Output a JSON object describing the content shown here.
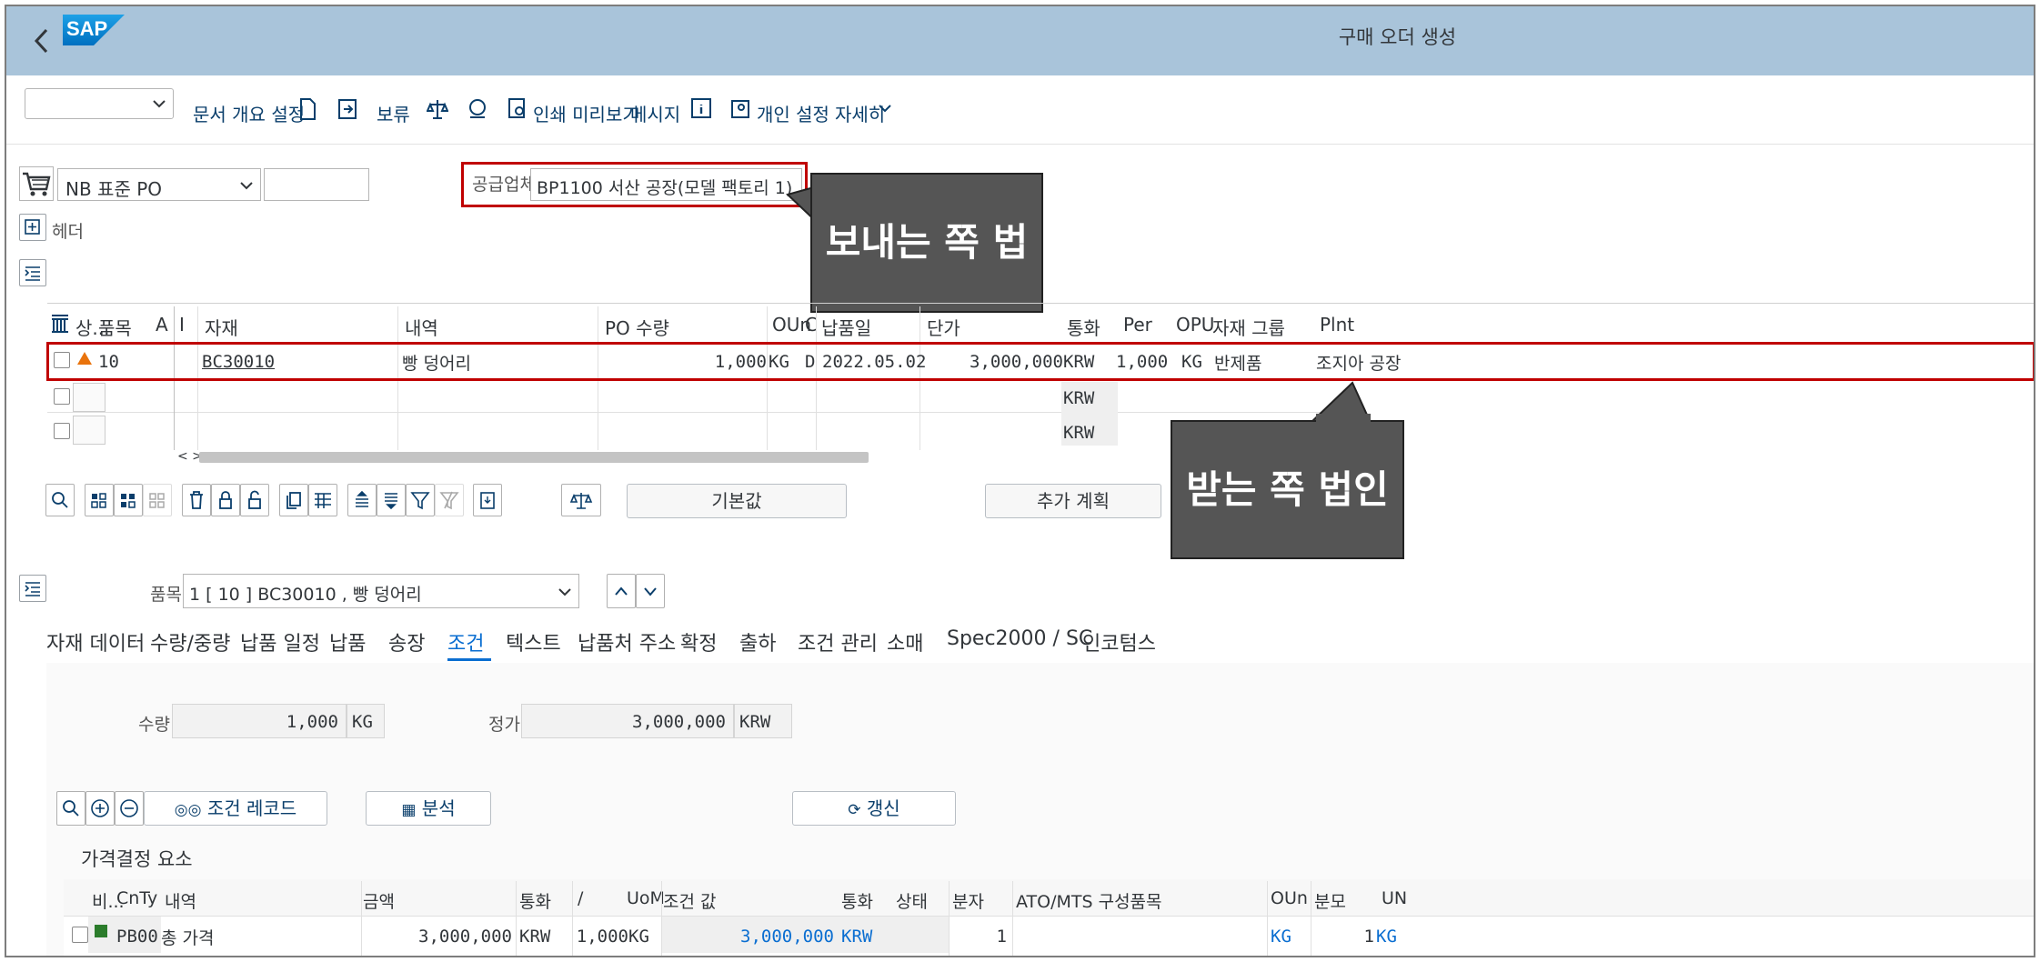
{
  "shell": {
    "title": "구매 오더 생성",
    "logo_text": "SAP"
  },
  "toolbar": {
    "dropdown_value": "",
    "items": [
      "문서 개요 설정",
      "보류",
      "인쇄 미리보기",
      "메시지",
      "개인 설정",
      "자세히"
    ]
  },
  "header": {
    "po_type": "NB 표준 PO",
    "po_number": "",
    "header_label": "헤더",
    "vendor_label": "공급업체:",
    "vendor_value": "BP1100 서산 공장(모델 팩토리 1)"
  },
  "callouts": {
    "sender": "보내는 쪽 법인",
    "receiver": "받는 쪽 법인"
  },
  "items_table": {
    "columns": [
      "상...",
      "품목",
      "A",
      "I",
      "자재",
      "내역",
      "PO 수량",
      "OUn",
      "C",
      "납품일",
      "단가",
      "통화",
      "Per",
      "OPU",
      "자재 그룹",
      "Plnt"
    ],
    "rows": [
      {
        "item": "10",
        "material": "BC30010",
        "desc": "빵 덩어리",
        "qty": "1,000",
        "oun": "KG",
        "c": "D",
        "date": "2022.05.02",
        "price": "3,000,000",
        "currency": "KRW",
        "per": "1,000",
        "opu": "KG",
        "group": "반제품",
        "plant": "조지아 공장"
      },
      {
        "currency": "KRW"
      },
      {
        "currency": "KRW"
      }
    ],
    "scroll_label": "< >"
  },
  "item_buttons": {
    "default_values": "기본값",
    "add_planning": "추가 계획"
  },
  "detail": {
    "item_label": "품목:",
    "item_value": "1 [ 10 ] BC30010 , 빵 덩어리",
    "tabs": [
      "자재 데이터",
      "수량/중량",
      "납품 일정",
      "납품",
      "송장",
      "조건",
      "텍스트",
      "납품처 주소",
      "확정",
      "출하",
      "조건 관리",
      "소매",
      "Spec2000 / SC",
      "인코텀스"
    ],
    "active_tab": "조건",
    "qty_label": "수량:",
    "qty_value": "1,000",
    "qty_unit": "KG",
    "net_label": "정가:",
    "net_value": "3,000,000",
    "net_currency": "KRW",
    "cond_record_btn": "조건 레코드",
    "analysis_btn": "분석",
    "update_btn": "갱신",
    "pricing_title": "가격결정 요소"
  },
  "pricing_table": {
    "columns": [
      "비...",
      "CnTy",
      "내역",
      "금액",
      "통화",
      "/",
      "UoM",
      "조건 값",
      "통화",
      "상태",
      "분자",
      "ATO/MTS 구성품목",
      "OUn",
      "분모",
      "UN"
    ],
    "rows": [
      {
        "cnty": "PB00",
        "desc": "총 가격",
        "amount": "3,000,000",
        "currency": "KRW",
        "per": "1,000",
        "uom": "KG",
        "cond_value": "3,000,000",
        "cond_currency": "KRW",
        "numerator": "1",
        "oun": "KG",
        "denominator": "1",
        "un": "KG"
      }
    ]
  },
  "colors": {
    "shell": "#a9c4da",
    "accent": "#0a6ed1",
    "red": "#c00000",
    "callout": "#555555",
    "warning": "#e9730c",
    "status_green": "#2b7c2b"
  }
}
